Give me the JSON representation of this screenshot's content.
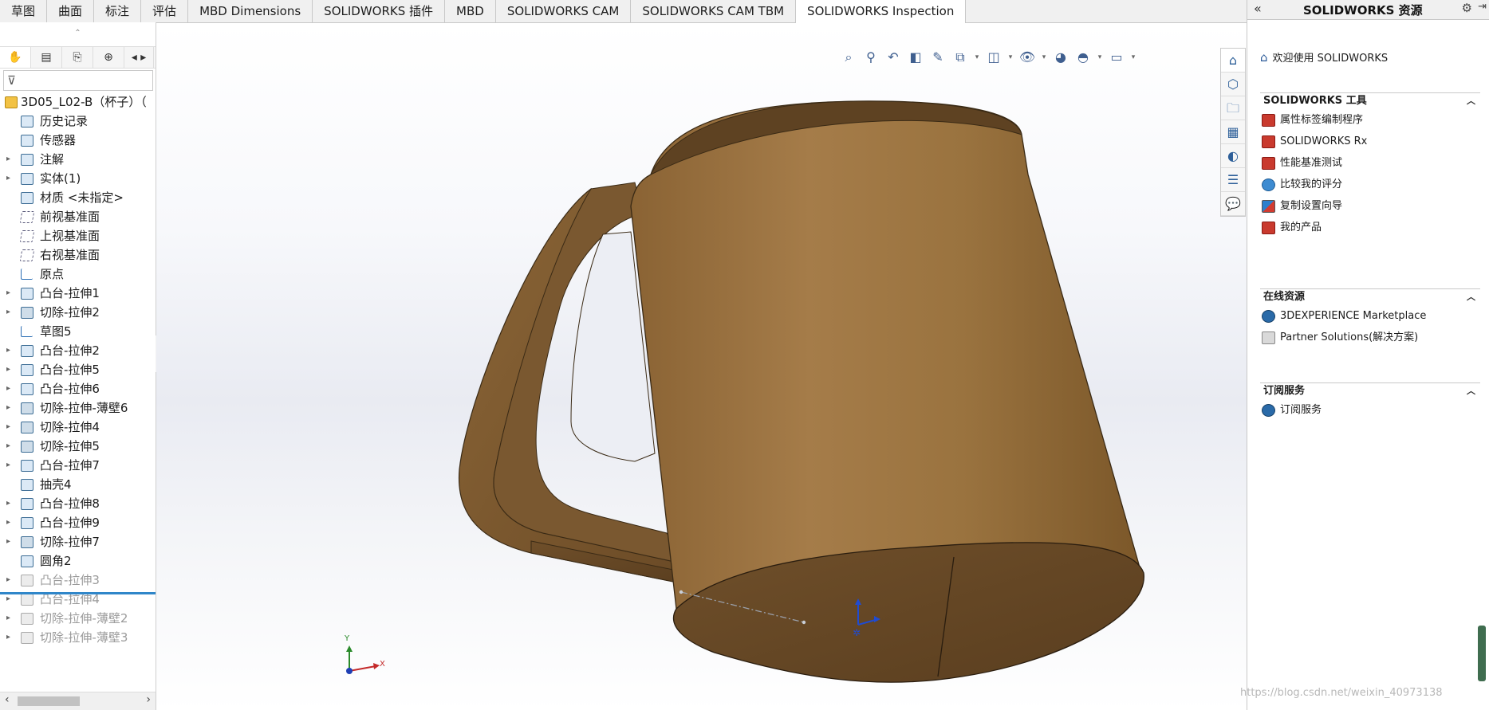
{
  "tabs": [
    {
      "label": "草图"
    },
    {
      "label": "曲面"
    },
    {
      "label": "标注"
    },
    {
      "label": "评估"
    },
    {
      "label": "MBD Dimensions"
    },
    {
      "label": "SOLIDWORKS 插件"
    },
    {
      "label": "MBD"
    },
    {
      "label": "SOLIDWORKS CAM"
    },
    {
      "label": "SOLIDWORKS CAM TBM"
    },
    {
      "label": "SOLIDWORKS Inspection"
    }
  ],
  "feature_tree": {
    "root": "3D05_L02-B（杯子）（",
    "items": [
      {
        "label": "历史记录",
        "expandable": false,
        "icon": "history-icon"
      },
      {
        "label": "传感器",
        "expandable": false,
        "icon": "sensor-icon"
      },
      {
        "label": "注解",
        "expandable": true,
        "icon": "annotation-icon"
      },
      {
        "label": "实体(1)",
        "expandable": true,
        "icon": "solid-body-icon"
      },
      {
        "label": "材质 <未指定>",
        "expandable": false,
        "icon": "material-icon"
      },
      {
        "label": "前视基准面",
        "expandable": false,
        "icon": "plane-icon"
      },
      {
        "label": "上视基准面",
        "expandable": false,
        "icon": "plane-icon"
      },
      {
        "label": "右视基准面",
        "expandable": false,
        "icon": "plane-icon"
      },
      {
        "label": "原点",
        "expandable": false,
        "icon": "origin-icon"
      },
      {
        "label": "凸台-拉伸1",
        "expandable": true,
        "icon": "boss-extrude-icon"
      },
      {
        "label": "切除-拉伸2",
        "expandable": true,
        "icon": "cut-extrude-icon"
      },
      {
        "label": "草图5",
        "expandable": false,
        "icon": "sketch-icon"
      },
      {
        "label": "凸台-拉伸2",
        "expandable": true,
        "icon": "boss-extrude-icon"
      },
      {
        "label": "凸台-拉伸5",
        "expandable": true,
        "icon": "boss-extrude-icon"
      },
      {
        "label": "凸台-拉伸6",
        "expandable": true,
        "icon": "boss-extrude-icon"
      },
      {
        "label": "切除-拉伸-薄壁6",
        "expandable": true,
        "icon": "cut-extrude-icon"
      },
      {
        "label": "切除-拉伸4",
        "expandable": true,
        "icon": "cut-extrude-icon"
      },
      {
        "label": "切除-拉伸5",
        "expandable": true,
        "icon": "cut-extrude-icon"
      },
      {
        "label": "凸台-拉伸7",
        "expandable": true,
        "icon": "boss-extrude-icon"
      },
      {
        "label": "抽壳4",
        "expandable": false,
        "icon": "shell-icon"
      },
      {
        "label": "凸台-拉伸8",
        "expandable": true,
        "icon": "boss-extrude-icon"
      },
      {
        "label": "凸台-拉伸9",
        "expandable": true,
        "icon": "boss-extrude-icon"
      },
      {
        "label": "切除-拉伸7",
        "expandable": true,
        "icon": "cut-extrude-icon"
      },
      {
        "label": "圆角2",
        "expandable": false,
        "icon": "fillet-icon"
      }
    ],
    "suppressed": [
      {
        "label": "凸台-拉伸3"
      },
      {
        "label": "凸台-拉伸4"
      },
      {
        "label": "切除-拉伸-薄壁2"
      },
      {
        "label": "切除-拉伸-薄壁3"
      }
    ]
  },
  "triad": {
    "x": "X",
    "y": "Y"
  },
  "resources": {
    "title": "SOLIDWORKS 资源",
    "welcome": "欢迎使用  SOLIDWORKS",
    "sections": [
      {
        "title": "SOLIDWORKS 工具",
        "items": [
          {
            "label": "属性标签编制程序",
            "icon": "property-tab-builder-icon"
          },
          {
            "label": "SOLIDWORKS Rx",
            "icon": "solidworks-rx-icon"
          },
          {
            "label": "性能基准测试",
            "icon": "benchmark-icon"
          },
          {
            "label": "比较我的评分",
            "icon": "compare-score-icon"
          },
          {
            "label": "复制设置向导",
            "icon": "copy-settings-icon"
          },
          {
            "label": "我的产品",
            "icon": "my-products-icon"
          }
        ]
      },
      {
        "title": "在线资源",
        "items": [
          {
            "label": "3DEXPERIENCE Marketplace",
            "icon": "marketplace-icon"
          },
          {
            "label": "Partner Solutions(解决方案)",
            "icon": "partner-solutions-icon"
          }
        ]
      },
      {
        "title": "订阅服务",
        "items": [
          {
            "label": "订阅服务",
            "icon": "subscription-icon"
          }
        ]
      }
    ]
  },
  "watermark": "https://blog.csdn.net/weixin_40973138",
  "colors": {
    "mug_light": "#a8824f",
    "mug_dark": "#6f4f2a",
    "accent_blue": "#2f86c9"
  }
}
